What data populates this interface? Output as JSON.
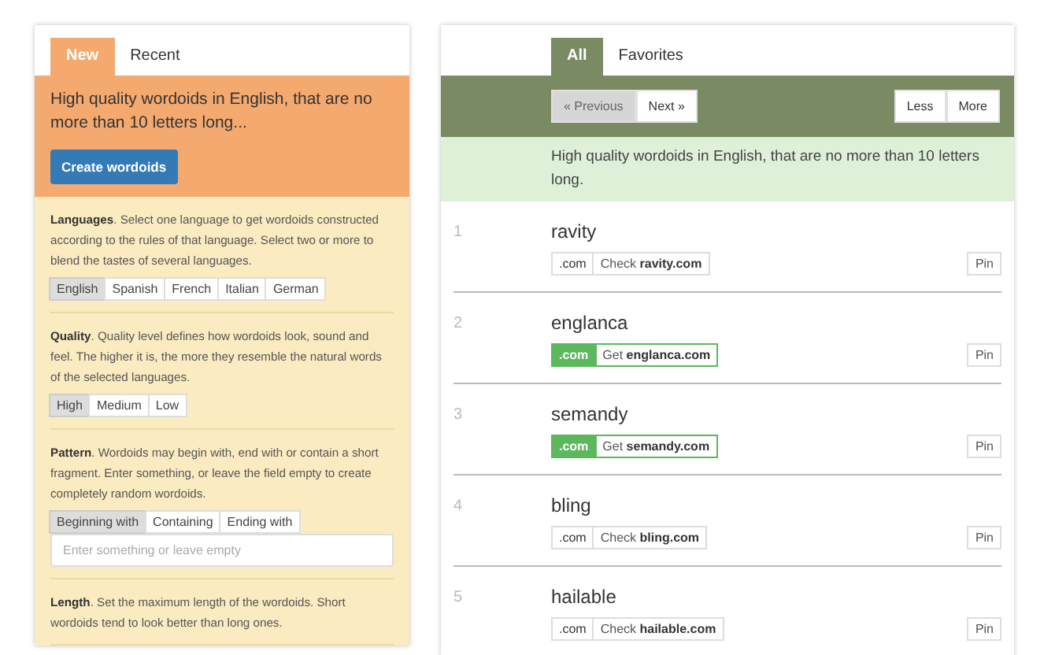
{
  "left_panel": {
    "tabs": [
      {
        "label": "New",
        "selected": true
      },
      {
        "label": "Recent",
        "selected": false
      }
    ],
    "summary": "High quality wordoids in English, that are no more than 10 letters long...",
    "create_button": "Create wordoids",
    "sections": [
      {
        "kind": "options",
        "text": "**Languages**. Select one language to get wordoids constructed according to the rules of that language. Select two or more to blend the tastes of several languages.",
        "options": [
          {
            "label": "English",
            "selected": true
          },
          {
            "label": "Spanish",
            "selected": false
          },
          {
            "label": "French",
            "selected": false
          },
          {
            "label": "Italian",
            "selected": false
          },
          {
            "label": "German",
            "selected": false
          }
        ]
      },
      {
        "kind": "options",
        "text": "**Quality**. Quality level defines how wordoids look, sound and feel. The higher it is, the more they resemble the natural words of the selected languages.",
        "options": [
          {
            "label": "High",
            "selected": true
          },
          {
            "label": "Medium",
            "selected": false
          },
          {
            "label": "Low",
            "selected": false
          }
        ]
      },
      {
        "kind": "pattern",
        "text": "**Pattern**. Wordoids may begin with, end with or contain a short fragment. Enter something, or leave the field empty to create completely random wordoids.",
        "options": [
          {
            "label": "Beginning with",
            "selected": true
          },
          {
            "label": "Containing",
            "selected": false
          },
          {
            "label": "Ending with",
            "selected": false
          }
        ],
        "placeholder": "Enter something or leave empty"
      },
      {
        "kind": "text",
        "text": "**Length**. Set the maximum length of the wordoids. Short wordoids tend to look better than long ones."
      }
    ]
  },
  "right_panel": {
    "tabs": [
      {
        "label": "All",
        "selected": true
      },
      {
        "label": "Favorites",
        "selected": false
      }
    ],
    "pager": [
      {
        "label": "« Previous",
        "disabled": true
      },
      {
        "label": "Next »",
        "disabled": false
      }
    ],
    "size_buttons": [
      "Less",
      "More"
    ],
    "summary": "High quality wordoids in English, that are no more than 10 letters long.",
    "words": [
      {
        "number": "1",
        "word": "ravity",
        "tld": ".com",
        "available": false,
        "link": "Check **ravity.com**",
        "pin": "Pin"
      },
      {
        "number": "2",
        "word": "englanca",
        "tld": ".com",
        "available": true,
        "link": "Get **englanca.com**",
        "pin": "Pin"
      },
      {
        "number": "3",
        "word": "semandy",
        "tld": ".com",
        "available": true,
        "link": "Get **semandy.com**",
        "pin": "Pin"
      },
      {
        "number": "4",
        "word": "bling",
        "tld": ".com",
        "available": false,
        "link": "Check **bling.com**",
        "pin": "Pin"
      },
      {
        "number": "5",
        "word": "hailable",
        "tld": ".com",
        "available": false,
        "link": "Check **hailable.com**",
        "pin": "Pin"
      }
    ]
  }
}
